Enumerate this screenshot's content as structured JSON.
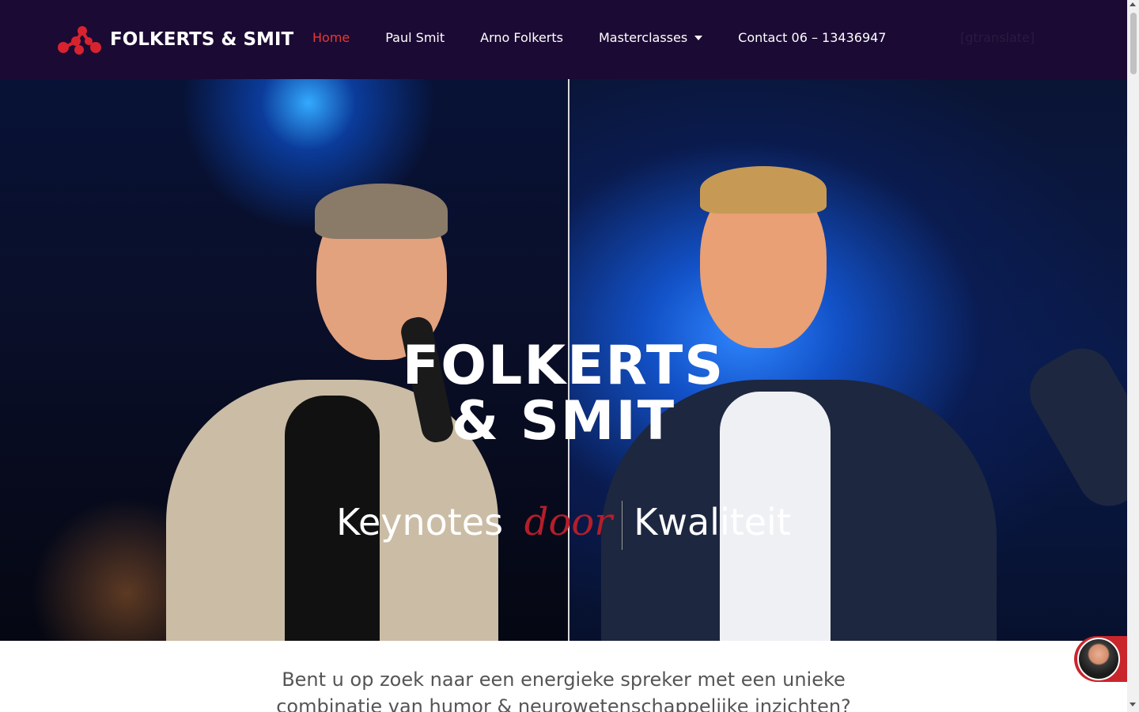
{
  "header": {
    "logo_text": "FOLKERTS & SMIT",
    "nav": [
      {
        "label": "Home",
        "active": true
      },
      {
        "label": "Paul Smit",
        "active": false
      },
      {
        "label": "Arno Folkerts",
        "active": false
      },
      {
        "label": "Masterclasses",
        "active": false,
        "has_dropdown": true
      },
      {
        "label": "Contact 06 – 13436947",
        "active": false
      }
    ],
    "gtranslate": "[gtranslate]"
  },
  "hero": {
    "title_line1": "FOLKERTS",
    "title_line2": "& SMIT",
    "subtitle_left": "Keynotes",
    "subtitle_accent": "door",
    "subtitle_right": "Kwaliteit"
  },
  "intro": {
    "line1": "Bent u op zoek naar een energieke spreker met een unieke",
    "line2": "combinatie van humor & neurowetenschappelijke inzichten?"
  },
  "colors": {
    "header_bg": "#1b0a33",
    "accent_red": "#e53935",
    "logo_red": "#d7232f"
  },
  "icons": {
    "logo": "molecule-logo-icon",
    "dropdown": "chevron-down-icon",
    "chat": "chat-avatar-icon"
  }
}
